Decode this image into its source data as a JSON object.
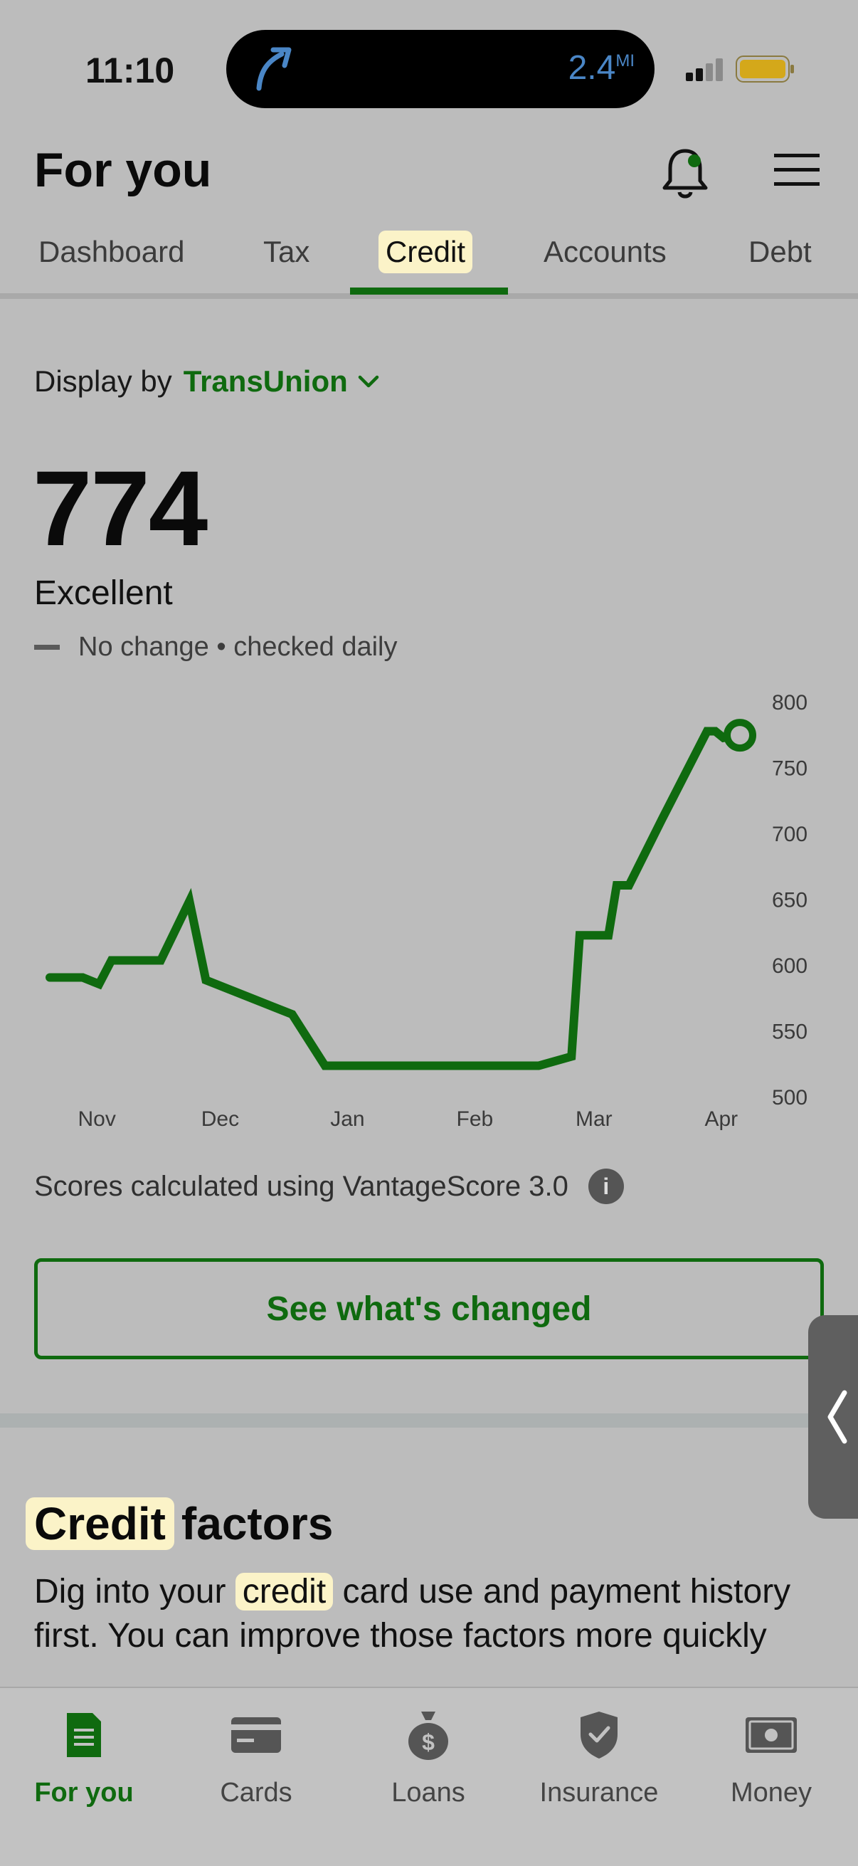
{
  "status_bar": {
    "time": "11:10",
    "nav_distance": "2.4",
    "nav_distance_unit": "MI"
  },
  "header": {
    "title": "For you"
  },
  "tabs": [
    {
      "label": "Dashboard",
      "active": false
    },
    {
      "label": "Tax",
      "active": false
    },
    {
      "label": "Credit",
      "active": true
    },
    {
      "label": "Accounts",
      "active": false
    },
    {
      "label": "Debt",
      "active": false
    }
  ],
  "display_by": {
    "label": "Display by",
    "bureau": "TransUnion"
  },
  "score": {
    "value": "774",
    "rating": "Excellent",
    "change_text": "No change • checked daily"
  },
  "chart_data": {
    "type": "line",
    "x_tick_labels": [
      "Nov",
      "Dec",
      "Jan",
      "Feb",
      "Mar",
      "Apr"
    ],
    "y_tick_labels": [
      "800",
      "750",
      "700",
      "650",
      "600",
      "550",
      "500"
    ],
    "ylim": [
      500,
      800
    ],
    "series": [
      {
        "points": [
          [
            "Oct 24",
            590
          ],
          [
            "Nov 1",
            590
          ],
          [
            "Nov 5",
            585
          ],
          [
            "Nov 8",
            603
          ],
          [
            "Nov 20",
            603
          ],
          [
            "Nov 27",
            648
          ],
          [
            "Dec 1",
            588
          ],
          [
            "Dec 22",
            562
          ],
          [
            "Dec 30",
            523
          ],
          [
            "Feb 20",
            523
          ],
          [
            "Feb 28",
            530
          ],
          [
            "Mar 1",
            622
          ],
          [
            "Mar 8",
            622
          ],
          [
            "Mar 10",
            660
          ],
          [
            "Mar 13",
            660
          ],
          [
            "Mar 21",
            710
          ],
          [
            "Apr 1",
            777
          ],
          [
            "Apr 3",
            777
          ],
          [
            "Apr 5",
            772
          ],
          [
            "Apr 9",
            774
          ]
        ]
      }
    ],
    "current_marker": {
      "date": "Apr 9",
      "value": 774
    },
    "line_color": "#0f6a0f",
    "grid": false
  },
  "scores_note": "Scores calculated using VantageScore 3.0",
  "cta_label": "See what's changed",
  "factors": {
    "title_highlight": "Credit",
    "title_rest": "factors",
    "body_before": "Dig into your ",
    "body_highlight": "credit",
    "body_after": " card use and payment history first. You can improve those factors more quickly"
  },
  "bottom_nav": [
    {
      "label": "For you",
      "icon": "document-icon",
      "active": true
    },
    {
      "label": "Cards",
      "icon": "card-icon",
      "active": false
    },
    {
      "label": "Loans",
      "icon": "money-bag-icon",
      "active": false
    },
    {
      "label": "Insurance",
      "icon": "shield-check-icon",
      "active": false
    },
    {
      "label": "Money",
      "icon": "banknote-icon",
      "active": false
    }
  ],
  "colors": {
    "accent": "#0f6a0f",
    "highlight": "#fbf3c8",
    "background": "#bcbcbc"
  }
}
